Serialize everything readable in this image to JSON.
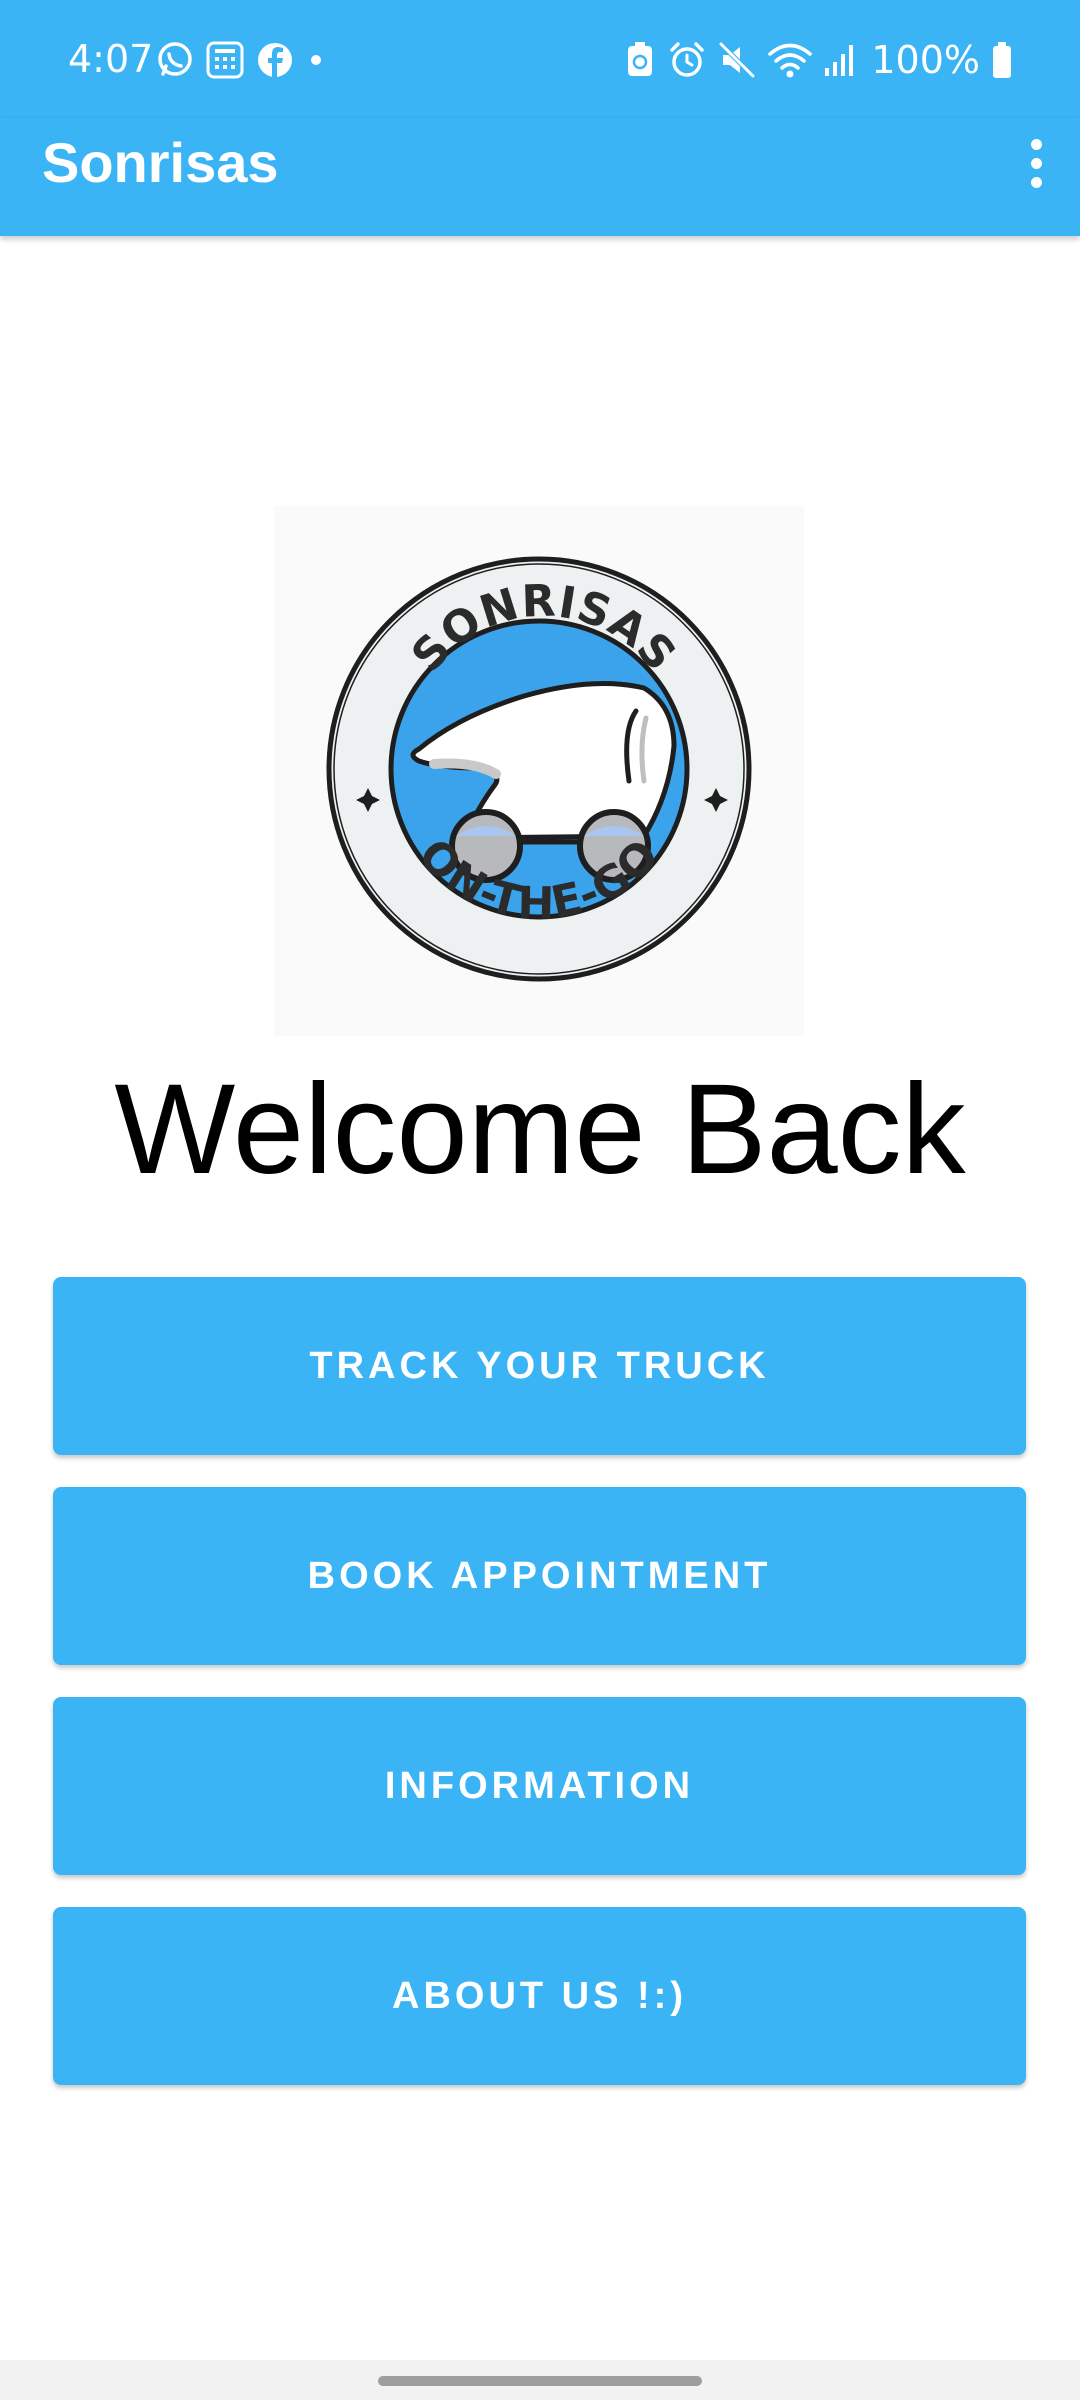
{
  "status_bar": {
    "time": "4:07",
    "battery": "100%",
    "left_icons": [
      "whatsapp-icon",
      "calculator-icon",
      "facebook-icon",
      "notification-dot-icon"
    ],
    "right_icons": [
      "battery-saver-icon",
      "alarm-icon",
      "mute-icon",
      "wifi-icon",
      "signal-icon",
      "battery-icon"
    ]
  },
  "app_bar": {
    "title": "Sonrisas",
    "menu_icon": "more-vert-icon"
  },
  "logo": {
    "top_text": "SONRISAS",
    "bottom_text": "ON-THE-GO"
  },
  "welcome": {
    "heading": "Welcome Back"
  },
  "buttons": [
    {
      "label": "TRACK YOUR TRUCK"
    },
    {
      "label": "BOOK APPOINTMENT"
    },
    {
      "label": "INFORMATION"
    },
    {
      "label": "ABOUT US !:)"
    }
  ],
  "colors": {
    "primary": "#3bb4f6",
    "on_primary": "#ffffff",
    "background": "#ffffff",
    "logo_circle_blue": "#3aa3ec"
  }
}
